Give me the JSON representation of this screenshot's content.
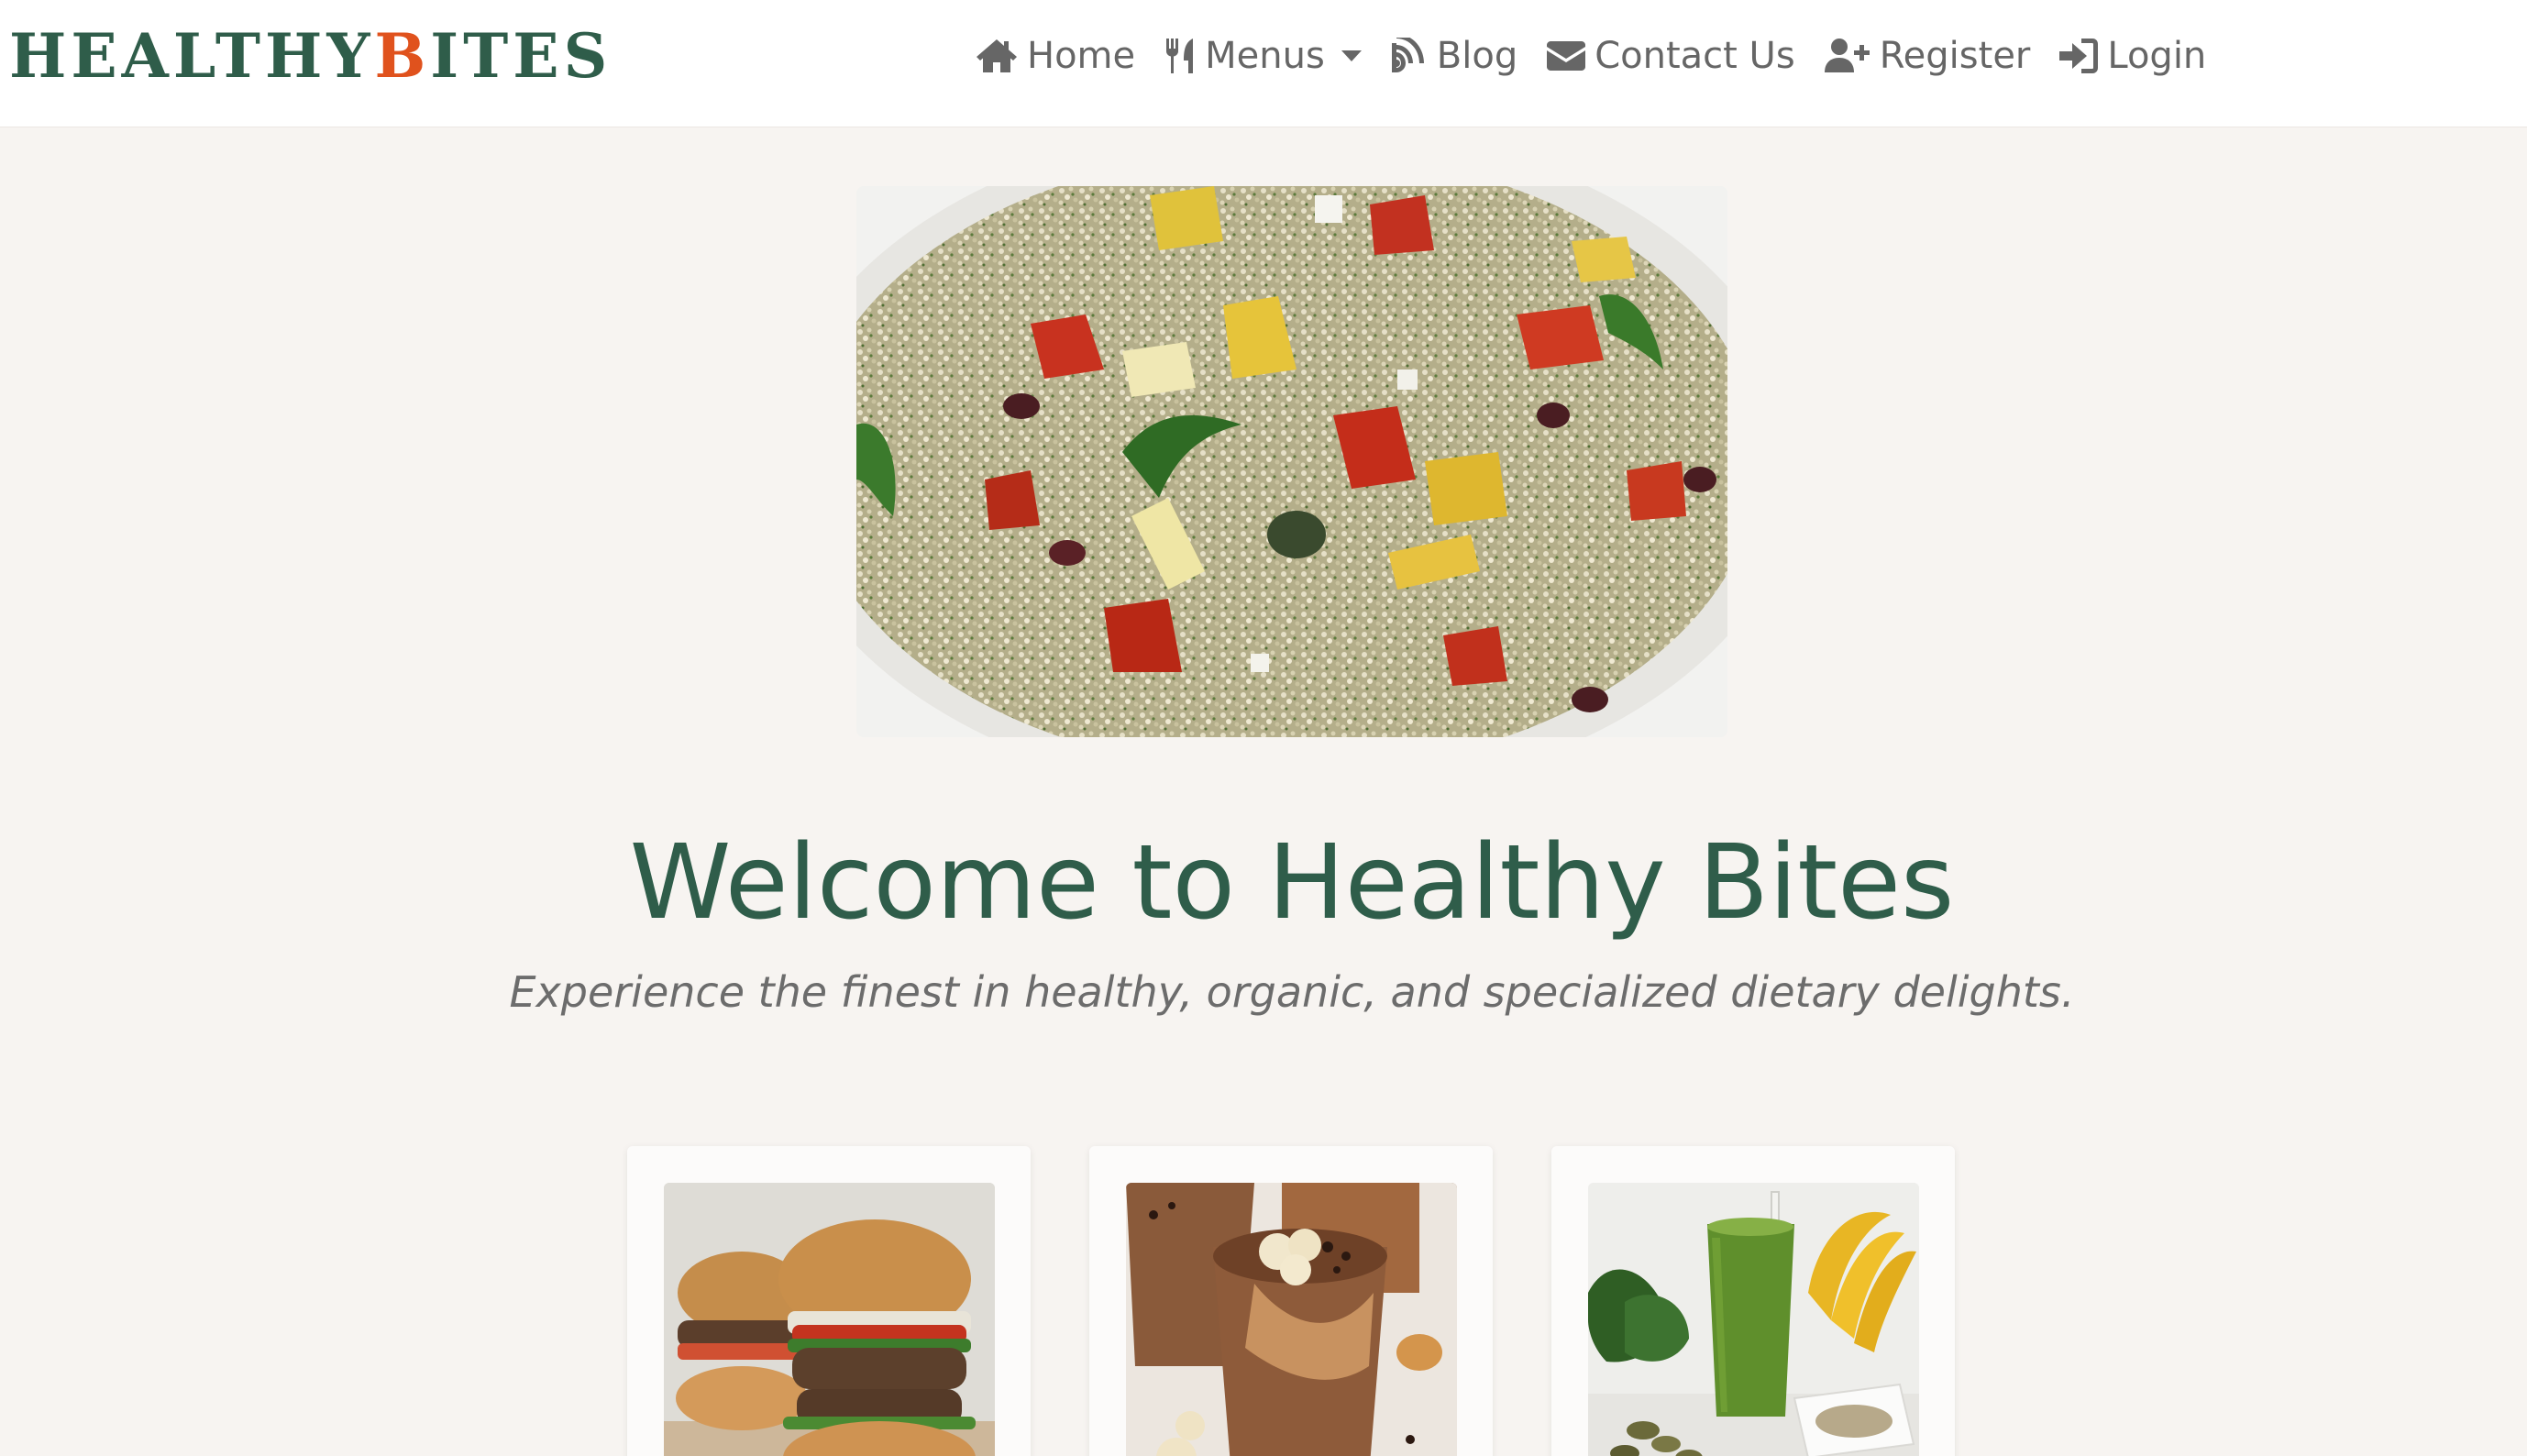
{
  "brand": {
    "part1": "HEALTHY",
    "part2": "B",
    "part3": "ITES"
  },
  "nav": {
    "home": "Home",
    "menus": "Menus",
    "blog": "Blog",
    "contact": "Contact Us",
    "register": "Register",
    "login": "Login"
  },
  "hero": {
    "title": "Welcome to Healthy Bites",
    "subtitle": "Experience the finest in healthy, organic, and specialized dietary delights."
  },
  "colors": {
    "brand_green": "#2f5d4a",
    "brand_orange": "#e0521d",
    "background": "#f7f4f1"
  },
  "cards": [
    {
      "image": "veggie-burger-photo"
    },
    {
      "image": "chocolate-banana-smoothie-photo"
    },
    {
      "image": "green-smoothie-photo"
    }
  ]
}
